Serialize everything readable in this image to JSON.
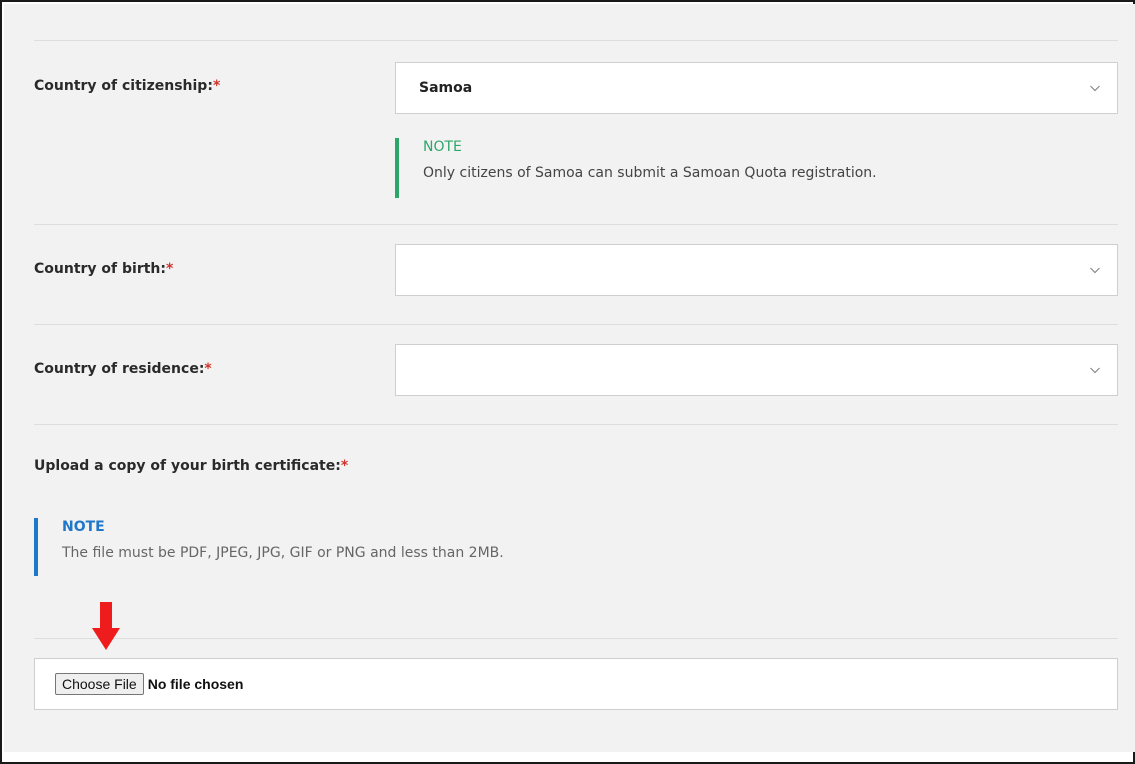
{
  "form": {
    "citizenship": {
      "label": "Country of citizenship:",
      "required_mark": "*",
      "selected_value": "Samoa",
      "note_title": "NOTE",
      "note_text": "Only citizens of Samoa can submit a Samoan Quota registration."
    },
    "birth": {
      "label": "Country of birth:",
      "required_mark": "*",
      "selected_value": ""
    },
    "residence": {
      "label": "Country of residence:",
      "required_mark": "*",
      "selected_value": ""
    },
    "upload": {
      "label": "Upload a copy of your birth certificate:",
      "required_mark": "*",
      "note_title": "NOTE",
      "note_text": "The file must be PDF, JPEG, JPG, GIF or PNG and less than 2MB.",
      "button_label": "Choose File",
      "status_text": "No file chosen"
    }
  },
  "icons": {
    "dropdown": "chevron-down-icon",
    "annotation": "red-arrow-down-icon"
  },
  "colors": {
    "required": "#d0342c",
    "note_green": "#2ea66a",
    "note_blue": "#1f77c9",
    "annotation_arrow": "#ee1c1c",
    "panel_bg": "#f2f2f2"
  }
}
